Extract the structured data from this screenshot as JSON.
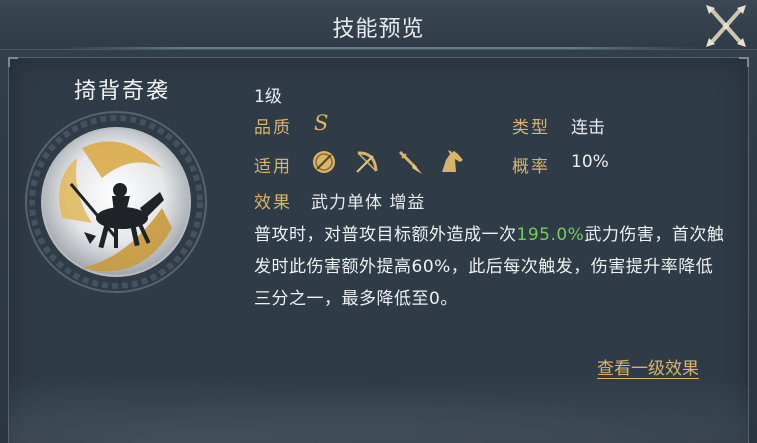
{
  "dialog": {
    "title": "技能预览",
    "close_icon": "close-x-icon"
  },
  "skill": {
    "name": "掎背奇袭",
    "level": "1级",
    "quality_label": "品质",
    "quality_value": "S",
    "type_label": "类型",
    "type_value": "连击",
    "applicable_label": "适用",
    "applicable_icons": [
      "shield-unit-icon",
      "bow-unit-icon",
      "spear-unit-icon",
      "cavalry-unit-icon"
    ],
    "chance_label": "概率",
    "chance_value": "10%",
    "effect_label": "效果",
    "effect_value": "武力单体 增益",
    "description_part1": "普攻时，对普攻目标额外造成一次",
    "description_highlight": "195.0%",
    "description_part2": "武力伤害，首次触发时此伤害额外提高60%，此后每次触发，伤害提升率降低三分之一，最多降低至0。",
    "view_link": "查看一级效果"
  },
  "colors": {
    "label_gold": "#d8b46a",
    "highlight_green": "#6fcf5a",
    "text_white": "#e9ecef"
  }
}
